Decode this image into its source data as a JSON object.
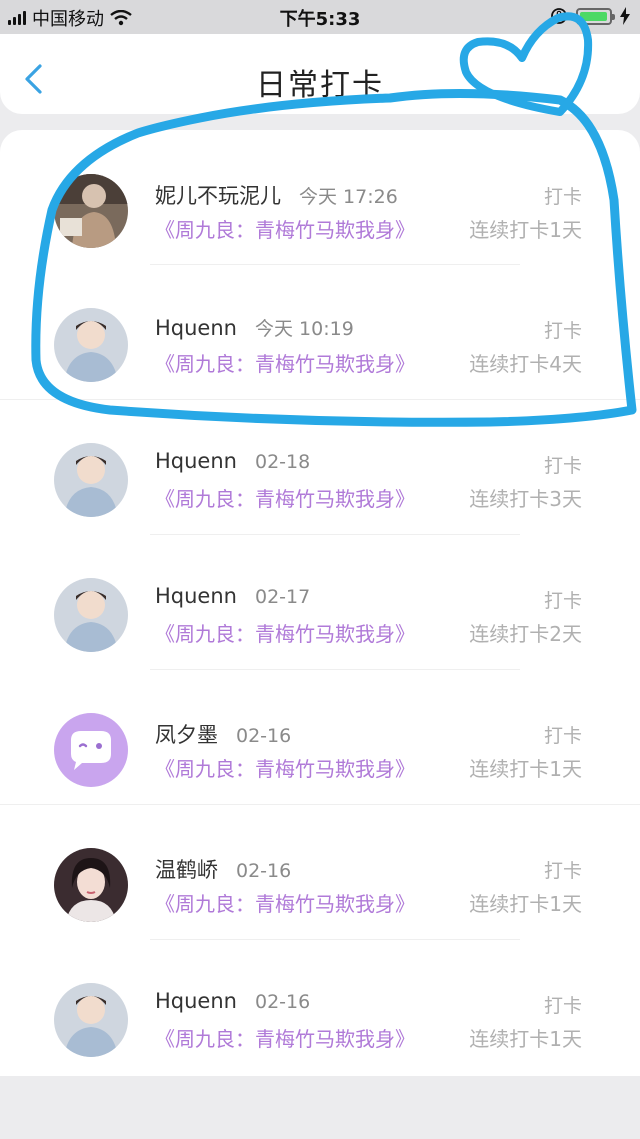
{
  "status_bar": {
    "carrier": "中国移动",
    "time": "下午5:33",
    "battery_fill_fraction": 0.95
  },
  "header": {
    "title": "日常打卡"
  },
  "colors": {
    "accent_blue": "#3aa3e3",
    "book_purple": "#b07ad8",
    "annotation_blue": "#27a8e6"
  },
  "entries": [
    {
      "user": "妮儿不玩泥儿",
      "time": "今天 17:26",
      "book": "《周九良：青梅竹马欺我身》",
      "action": "打卡",
      "streak": "连续打卡1天",
      "avatar_icon": "photo-avatar-dark"
    },
    {
      "user": "Hquenn",
      "time": "今天 10:19",
      "book": "《周九良：青梅竹马欺我身》",
      "action": "打卡",
      "streak": "连续打卡4天",
      "avatar_icon": "photo-avatar-boy"
    },
    {
      "user": "Hquenn",
      "time": "02-18",
      "book": "《周九良：青梅竹马欺我身》",
      "action": "打卡",
      "streak": "连续打卡3天",
      "avatar_icon": "photo-avatar-boy"
    },
    {
      "user": "Hquenn",
      "time": "02-17",
      "book": "《周九良：青梅竹马欺我身》",
      "action": "打卡",
      "streak": "连续打卡2天",
      "avatar_icon": "photo-avatar-boy"
    },
    {
      "user": "凤夕墨",
      "time": "02-16",
      "book": "《周九良：青梅竹马欺我身》",
      "action": "打卡",
      "streak": "连续打卡1天",
      "avatar_icon": "default-chat-avatar"
    },
    {
      "user": "温鹤峤",
      "time": "02-16",
      "book": "《周九良：青梅竹马欺我身》",
      "action": "打卡",
      "streak": "连续打卡1天",
      "avatar_icon": "photo-avatar-girl"
    },
    {
      "user": "Hquenn",
      "time": "02-16",
      "book": "《周九良：青梅竹马欺我身》",
      "action": "打卡",
      "streak": "连续打卡1天",
      "avatar_icon": "photo-avatar-boy"
    }
  ]
}
